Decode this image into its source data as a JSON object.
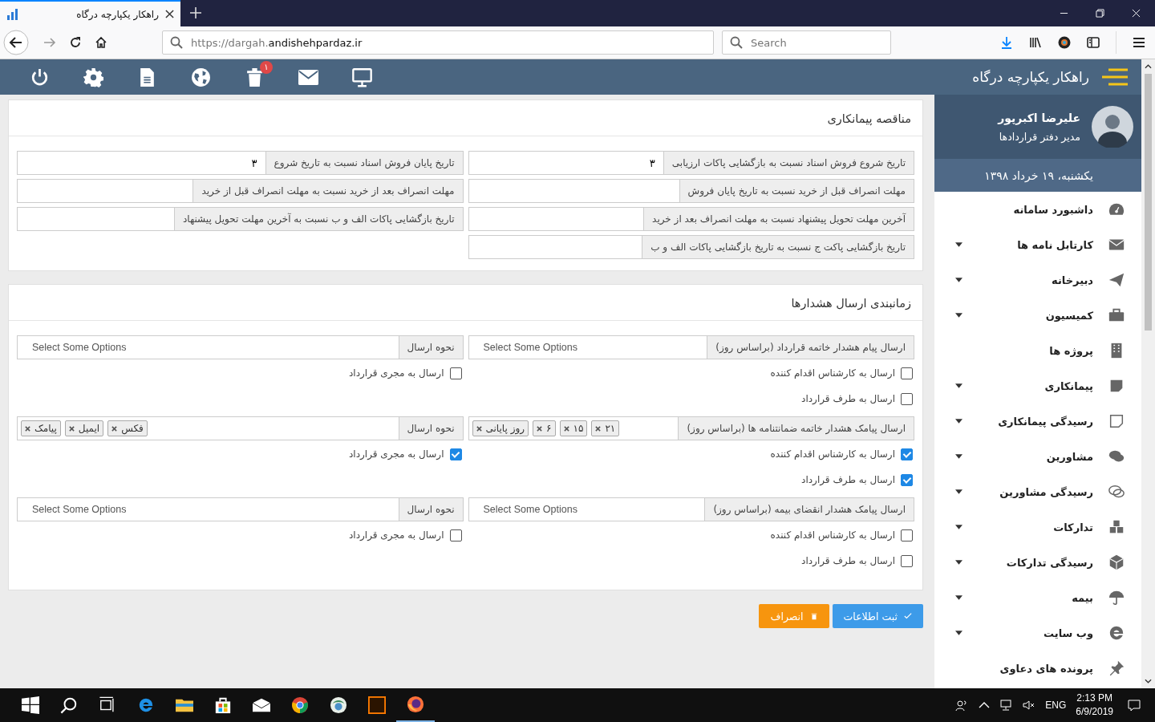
{
  "browser": {
    "tab_title": "راهکار یکپارچه درگاه",
    "url": {
      "prefix": "https://dargah.",
      "domain": "andishehpardaz.ir"
    },
    "search": {
      "placeholder": "Search"
    }
  },
  "header": {
    "title": "راهکار یکپارچه درگاه",
    "notification_badge": "۱"
  },
  "profile": {
    "name": "علیرضا اکبرپور",
    "role": "مدیر دفتر قراردادها",
    "date": "یکشنبه، ۱۹ خرداد ۱۳۹۸"
  },
  "menu": [
    {
      "label": "داشبورد سامانه",
      "expandable": false
    },
    {
      "label": "کارتابل نامه ها",
      "expandable": true
    },
    {
      "label": "دبیرخانه",
      "expandable": true
    },
    {
      "label": "کمیسیون",
      "expandable": true
    },
    {
      "label": "پروژه ها",
      "expandable": false
    },
    {
      "label": "پیمانکاری",
      "expandable": true
    },
    {
      "label": "رسیدگی پیمانکاری",
      "expandable": true
    },
    {
      "label": "مشاورین",
      "expandable": true
    },
    {
      "label": "رسیدگی مشاورین",
      "expandable": true
    },
    {
      "label": "تدارکات",
      "expandable": true
    },
    {
      "label": "رسیدگی تدارکات",
      "expandable": true
    },
    {
      "label": "بیمه",
      "expandable": true
    },
    {
      "label": "وب سایت",
      "expandable": true
    },
    {
      "label": "پرونده های دعاوی",
      "expandable": false
    }
  ],
  "tender": {
    "title": "مناقصه پیمانکاری",
    "fields": [
      {
        "label": "تاریخ شروع فروش اسناد نسبت به بازگشایی پاکات ارزیابی",
        "value": "۳"
      },
      {
        "label": "تاریخ پایان فروش اسناد نسبت به تاریخ شروع",
        "value": "۳"
      },
      {
        "label": "مهلت انصراف قبل از خرید نسبت به تاریخ پایان فروش"
      },
      {
        "label": "مهلت انصراف بعد از خرید نسبت به مهلت انصراف قبل از خرید"
      },
      {
        "label": "آخرین مهلت تحویل پیشنهاد نسبت به مهلت انصراف بعد از خرید"
      },
      {
        "label": "تاریخ بازگشایی پاکات الف و ب نسبت به آخرین مهلت تحویل پیشنهاد"
      },
      {
        "label": "تاریخ بازگشایی پاکت ج نسبت به تاریخ بازگشایی پاکات الف و ب"
      }
    ]
  },
  "alerts": {
    "title": "زمانبندی ارسال هشدارها",
    "groups": [
      {
        "days": {
          "label": "ارسال پیام هشدار خاتمه قرارداد (براساس روز)",
          "placeholder": "Select Some Options"
        },
        "method": {
          "label": "نحوه ارسال",
          "placeholder": "Select Some Options"
        },
        "right_checks": [
          {
            "label": "ارسال به کارشناس اقدام کننده",
            "checked": false
          },
          {
            "label": "ارسال به طرف قرارداد",
            "checked": false
          }
        ],
        "left_checks": [
          {
            "label": "ارسال به مجری قرارداد",
            "checked": false
          }
        ]
      },
      {
        "days": {
          "label": "ارسال پیامک هشدار خاتمه ضمانتنامه ها (براساس روز)",
          "tags": [
            "۲۱",
            "۱۵",
            "۶",
            "روز پایانی"
          ]
        },
        "method": {
          "label": "نحوه ارسال",
          "tags": [
            "فکس",
            "ایمیل",
            "پیامک"
          ]
        },
        "right_checks": [
          {
            "label": "ارسال به کارشناس اقدام کننده",
            "checked": true
          },
          {
            "label": "ارسال به طرف قرارداد",
            "checked": true
          }
        ],
        "left_checks": [
          {
            "label": "ارسال به مجری قرارداد",
            "checked": true
          }
        ]
      },
      {
        "days": {
          "label": "ارسال پیامک هشدار انقضای بیمه (براساس روز)",
          "placeholder": "Select Some Options"
        },
        "method": {
          "label": "نحوه ارسال",
          "placeholder": "Select Some Options"
        },
        "right_checks": [
          {
            "label": "ارسال به کارشناس اقدام کننده",
            "checked": false
          },
          {
            "label": "ارسال به طرف قرارداد",
            "checked": false
          }
        ],
        "left_checks": [
          {
            "label": "ارسال به مجری قرارداد",
            "checked": false
          }
        ]
      }
    ]
  },
  "actions": [
    {
      "label": "ثبت اطلاعات",
      "kind": "primary"
    },
    {
      "label": "انصراف",
      "kind": "cancel"
    }
  ],
  "taskbar": {
    "language": "ENG",
    "time": "2:13 PM",
    "date": "6/9/2019"
  }
}
